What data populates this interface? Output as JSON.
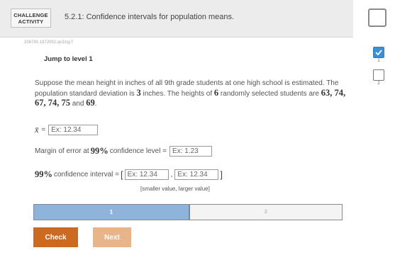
{
  "header": {
    "activity_label": "CHALLENGE\nACTIVITY",
    "title": "5.2.1: Confidence intervals for population means."
  },
  "activity_id": "336780.1872092.qx3zqy7",
  "jump_link": "Jump to level 1",
  "levels": [
    {
      "number": "1",
      "completed": true
    },
    {
      "number": "2",
      "completed": false
    }
  ],
  "problem": {
    "text_1": "Suppose the mean height in inches of all 9th grade students at one high school is estimated. The population standard deviation is ",
    "std_dev": "3",
    "text_2": " inches. The heights of ",
    "sample_size": "6",
    "text_3": " randomly selected students are ",
    "heights": "63, 74, 67, 74, 75",
    "text_4": " and ",
    "last_height": "69",
    "text_5": "."
  },
  "xbar": {
    "symbol": "x̄",
    "equals": "=",
    "placeholder": "Ex: 12.34"
  },
  "margin_of_error": {
    "label_pre": "Margin of error at",
    "confidence": "99%",
    "label_post": "confidence level =",
    "placeholder": "Ex: 1.23"
  },
  "confidence_interval": {
    "confidence": "99%",
    "label_post": "confidence interval =",
    "open_bracket": "[",
    "close_bracket": "]",
    "comma": ",",
    "lower_placeholder": "Ex: 12.34",
    "upper_placeholder": "Ex: 12.34",
    "hint": "[smaller value, larger value]"
  },
  "progress": {
    "segments": [
      "1",
      "2"
    ],
    "current": 1
  },
  "buttons": {
    "check": "Check",
    "next": "Next"
  },
  "colors": {
    "accent_orange": "#cc6a1f",
    "disabled_orange": "#e8b48a",
    "level_blue": "#3b8fd6",
    "progress_blue": "#8fb4dc"
  }
}
